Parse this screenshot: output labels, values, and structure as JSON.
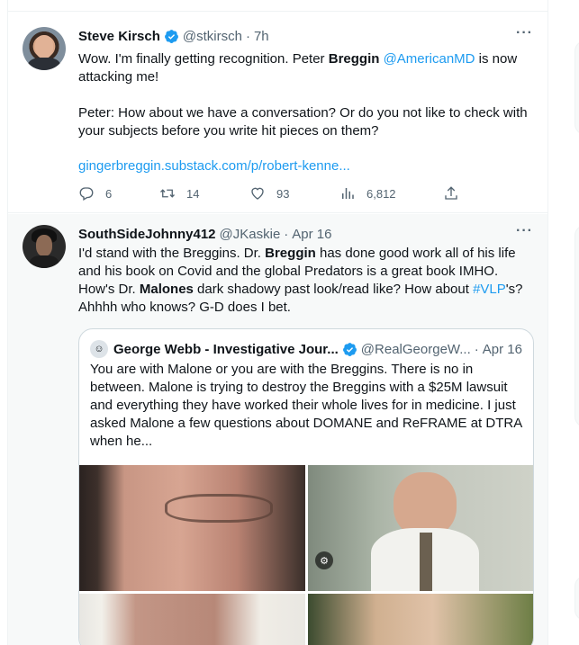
{
  "tweets": [
    {
      "name": "Steve Kirsch",
      "verified": true,
      "handle": "@stkirsch",
      "dot": "·",
      "time": "7h",
      "more": "···",
      "text_parts": [
        "Wow. I'm finally getting recognition. Peter ",
        "Breggin",
        " ",
        "@AmericanMD",
        " is now attacking me!"
      ],
      "text2": "Peter: How about we have a conversation? Or do you not like to check with your subjects before you write hit pieces on them?",
      "link": "gingerbreggin.substack.com/p/robert-kenne...",
      "replies": "6",
      "retweets": "14",
      "likes": "93",
      "views": "6,812"
    },
    {
      "name": "SouthSideJohnny412",
      "handle": "@JKaskie",
      "dot": "·",
      "time": "Apr 16",
      "more": "···",
      "t_a": "I'd stand with the Breggins. Dr. ",
      "t_b": "Breggin",
      "t_c": " has done good work all of his life and his book on Covid and the global Predators is a great book IMHO. How's Dr. ",
      "t_d": "Malones",
      "t_e": " dark shadowy past look/read like? How about ",
      "t_f": "#VLP",
      "t_g": "'s? Ahhhh who knows? G-D does I bet."
    }
  ],
  "quote": {
    "name": "George Webb - Investigative Jour...",
    "verified": true,
    "handle": "@RealGeorgeW...",
    "dot": "·",
    "time": "Apr 16",
    "text": "You are with Malone or you are with the Breggins. There is no in between. Malone is trying to destroy the Breggins with a $25M lawsuit and everything they have worked their whole lives for in medicine. I just asked Malone a few questions about DOMANE and ReFRAME at DTRA when he...",
    "alt_badge": "⚙"
  },
  "colors": {
    "link": "#1d9bf0",
    "muted": "#536471",
    "border": "#eff3f4"
  }
}
